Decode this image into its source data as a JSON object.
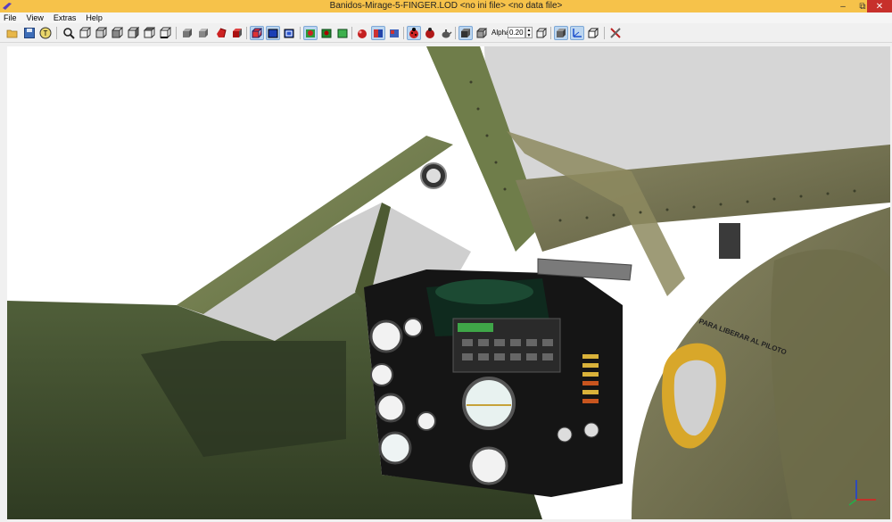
{
  "window": {
    "title": "Banidos-Mirage-5-FINGER.LOD  <no ini file>  <no data file>",
    "minimize_icon": "minimize-icon",
    "maximize_icon": "maximize-icon",
    "close_icon": "close-icon"
  },
  "menu": {
    "items": [
      "File",
      "View",
      "Extras",
      "Help"
    ]
  },
  "toolbar": {
    "alpha_label": "Alpha:",
    "alpha_value": "0.20",
    "buttons": [
      "open-folder-icon",
      "save-icon",
      "text-tool-icon",
      "zoom-icon",
      "cube-front-icon",
      "cube-back-icon",
      "cube-left-icon",
      "cube-right-icon",
      "cube-top-icon",
      "cube-bottom-icon",
      "solid-gray-cube-icon",
      "solid-gray-cube-2-icon",
      "red-sphere-icon",
      "red-cube-icon",
      "wire-red-cube-icon",
      "blue-cube-icon",
      "blue-wire-cube-icon",
      "green-refresh-icon",
      "green-cube-icon",
      "green-cube-2-icon",
      "red-sphere-shaded-icon",
      "texture-cube-icon",
      "blue-texture-cube-icon",
      "red-ladybug-icon",
      "red-bug-icon",
      "gray-teapot-icon",
      "solid-box-icon",
      "wire-box-icon",
      "alpha-cube-icon",
      "transparent-cube-icon",
      "axes-icon",
      "box-outline-icon",
      "tools-icon"
    ]
  },
  "viewport": {
    "scene": "3d-cockpit-render",
    "background": "#ffffff",
    "fuselage_color": "#3d4a2c",
    "canopy_frame_color": "#7c8459",
    "panel_color": "#1a1a1a"
  }
}
